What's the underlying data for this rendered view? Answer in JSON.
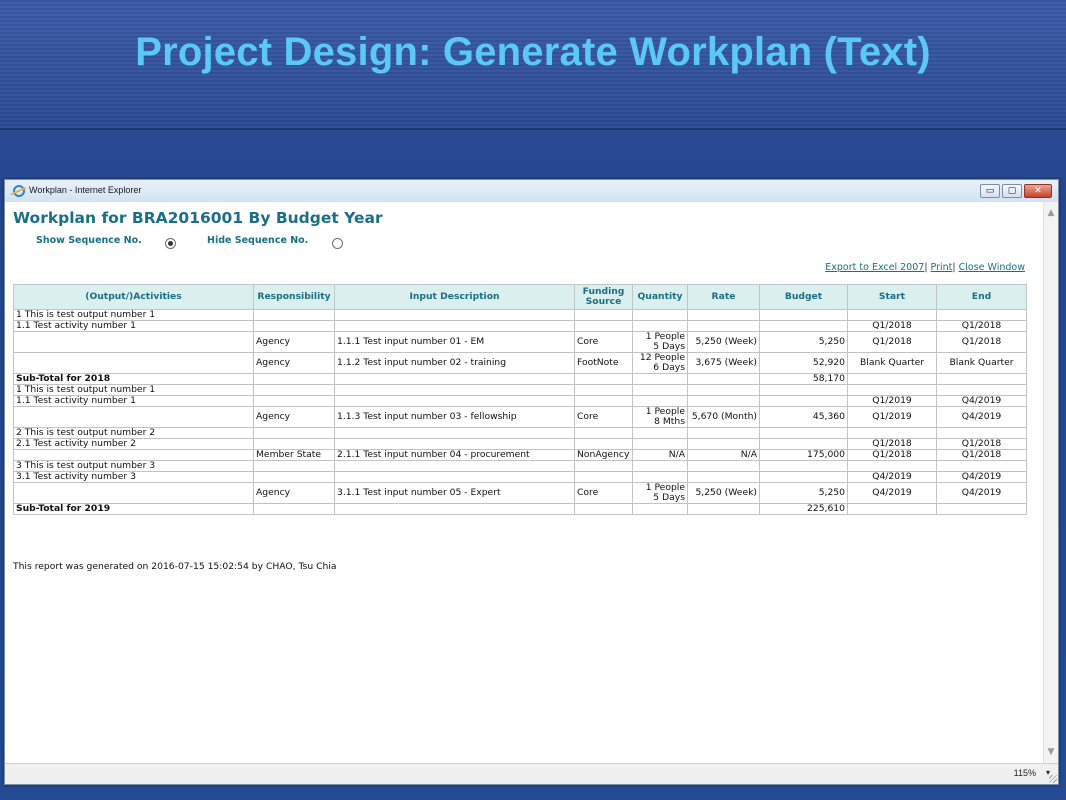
{
  "slide": {
    "title": "Project Design: Generate Workplan (Text)"
  },
  "window": {
    "title": "Workplan - Internet Explorer",
    "controls": {
      "minimize": "▭",
      "maximize": "▢",
      "close": "✕"
    },
    "zoom": "115%"
  },
  "report": {
    "title": "Workplan for BRA2016001 By Budget Year",
    "show_seq_label": "Show Sequence No.",
    "hide_seq_label": "Hide Sequence No.",
    "show_seq_selected": true,
    "links": {
      "export": "Export to Excel 2007",
      "print": "Print",
      "close": "Close Window",
      "sep": "|"
    },
    "columns": [
      "(Output/)Activities",
      "Responsibility",
      "Input Description",
      "Funding Source",
      "Quantity",
      "Rate",
      "Budget",
      "Start",
      "End"
    ],
    "rows": [
      {
        "activity": "1 This is test output number 1",
        "resp": "",
        "input": "",
        "funding": "",
        "qty": [
          "",
          ""
        ],
        "rate": "",
        "budget": "",
        "start": "",
        "end": ""
      },
      {
        "activity": "1.1 Test activity number 1",
        "resp": "",
        "input": "",
        "funding": "",
        "qty": [
          "",
          ""
        ],
        "rate": "",
        "budget": "",
        "start": "Q1/2018",
        "end": "Q1/2018"
      },
      {
        "activity": "",
        "resp": "Agency",
        "input": "1.1.1 Test input number 01 - EM",
        "funding": "Core",
        "qty": [
          "1 People",
          "5 Days"
        ],
        "rate": "5,250 (Week)",
        "budget": "5,250",
        "start": "Q1/2018",
        "end": "Q1/2018"
      },
      {
        "activity": "",
        "resp": "Agency",
        "input": "1.1.2 Test input number 02 - training",
        "funding": "FootNote",
        "qty": [
          "12 People",
          "6 Days"
        ],
        "rate": "3,675 (Week)",
        "budget": "52,920",
        "start": "Blank Quarter",
        "end": "Blank Quarter"
      },
      {
        "activity": "Sub-Total for 2018",
        "resp": "",
        "input": "",
        "funding": "",
        "qty": [
          "",
          ""
        ],
        "rate": "",
        "budget": "58,170",
        "start": "",
        "end": "",
        "subtotal": true
      },
      {
        "activity": "1 This is test output number 1",
        "resp": "",
        "input": "",
        "funding": "",
        "qty": [
          "",
          ""
        ],
        "rate": "",
        "budget": "",
        "start": "",
        "end": ""
      },
      {
        "activity": "1.1 Test activity number 1",
        "resp": "",
        "input": "",
        "funding": "",
        "qty": [
          "",
          ""
        ],
        "rate": "",
        "budget": "",
        "start": "Q1/2019",
        "end": "Q4/2019"
      },
      {
        "activity": "",
        "resp": "Agency",
        "input": "1.1.3 Test input number 03 - fellowship",
        "funding": "Core",
        "qty": [
          "1 People",
          "8 Mths"
        ],
        "rate": "5,670 (Month)",
        "budget": "45,360",
        "start": "Q1/2019",
        "end": "Q4/2019"
      },
      {
        "activity": "2 This is test output number 2",
        "resp": "",
        "input": "",
        "funding": "",
        "qty": [
          "",
          ""
        ],
        "rate": "",
        "budget": "",
        "start": "",
        "end": ""
      },
      {
        "activity": "2.1 Test activity number 2",
        "resp": "",
        "input": "",
        "funding": "",
        "qty": [
          "",
          ""
        ],
        "rate": "",
        "budget": "",
        "start": "Q1/2018",
        "end": "Q1/2018"
      },
      {
        "activity": "",
        "resp": "Member State",
        "input": "2.1.1 Test input number 04 - procurement",
        "funding": "NonAgency",
        "qty": [
          "N/A",
          ""
        ],
        "rate": "N/A",
        "budget": "175,000",
        "start": "Q1/2018",
        "end": "Q1/2018"
      },
      {
        "activity": "3 This is test output number 3",
        "resp": "",
        "input": "",
        "funding": "",
        "qty": [
          "",
          ""
        ],
        "rate": "",
        "budget": "",
        "start": "",
        "end": ""
      },
      {
        "activity": "3.1 Test activity number 3",
        "resp": "",
        "input": "",
        "funding": "",
        "qty": [
          "",
          ""
        ],
        "rate": "",
        "budget": "",
        "start": "Q4/2019",
        "end": "Q4/2019"
      },
      {
        "activity": "",
        "resp": "Agency",
        "input": "3.1.1 Test input number 05 - Expert",
        "funding": "Core",
        "qty": [
          "1 People",
          "5 Days"
        ],
        "rate": "5,250 (Week)",
        "budget": "5,250",
        "start": "Q4/2019",
        "end": "Q4/2019"
      },
      {
        "activity": "Sub-Total for 2019",
        "resp": "",
        "input": "",
        "funding": "",
        "qty": [
          "",
          ""
        ],
        "rate": "",
        "budget": "225,610",
        "start": "",
        "end": "",
        "subtotal": true
      }
    ],
    "footer": "This report was generated on 2016-07-15 15:02:54 by CHAO, Tsu Chia"
  }
}
